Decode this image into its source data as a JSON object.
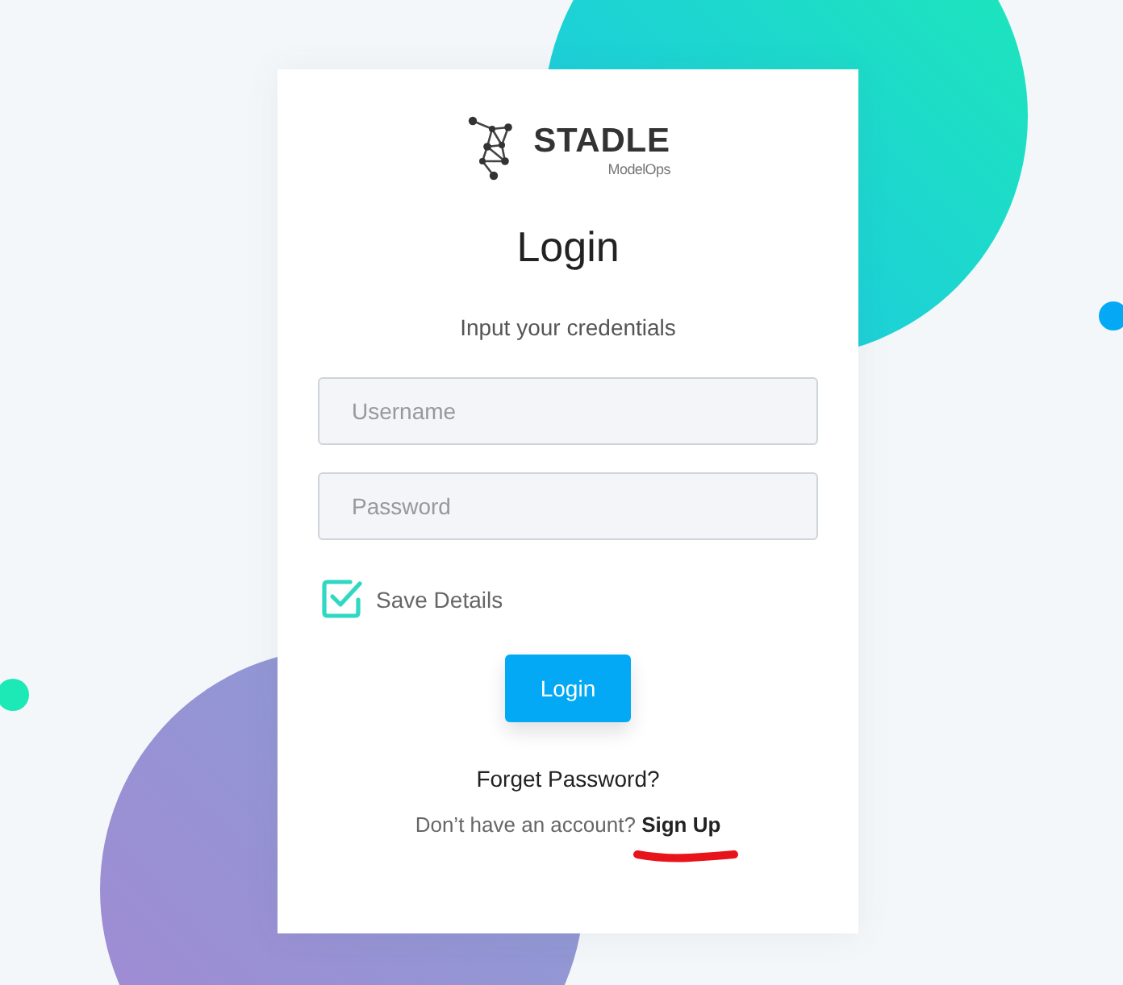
{
  "logo": {
    "name": "STADLE",
    "tagline": "ModelOps"
  },
  "title": "Login",
  "subtitle": "Input your credentials",
  "username": {
    "placeholder": "Username"
  },
  "password": {
    "placeholder": "Password"
  },
  "save_details": {
    "label": "Save Details",
    "checked": true
  },
  "login_button": "Login",
  "forgot_link": "Forget Password?",
  "signup": {
    "prompt": "Don’t have an account?",
    "link": "Sign Up"
  }
}
